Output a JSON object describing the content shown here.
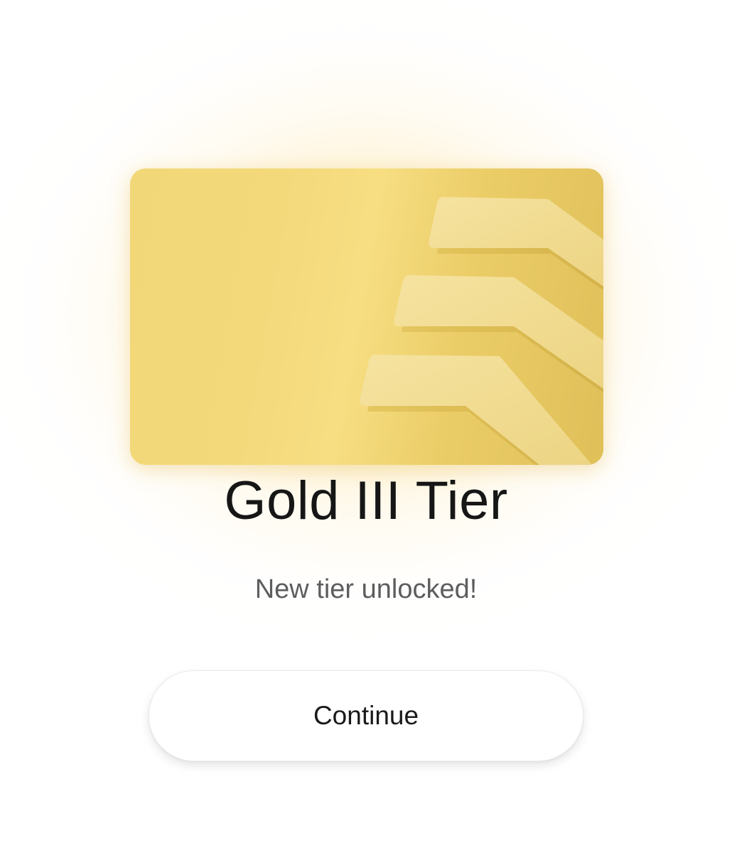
{
  "tier_card": {
    "icon": "chevron-stack-icon",
    "colors": {
      "gold_light": "#f7de82",
      "gold_mid": "#ebcd68",
      "gold_dark": "#dfbf58"
    }
  },
  "title": "Gold III Tier",
  "subtitle": "New tier unlocked!",
  "actions": {
    "continue_label": "Continue"
  }
}
